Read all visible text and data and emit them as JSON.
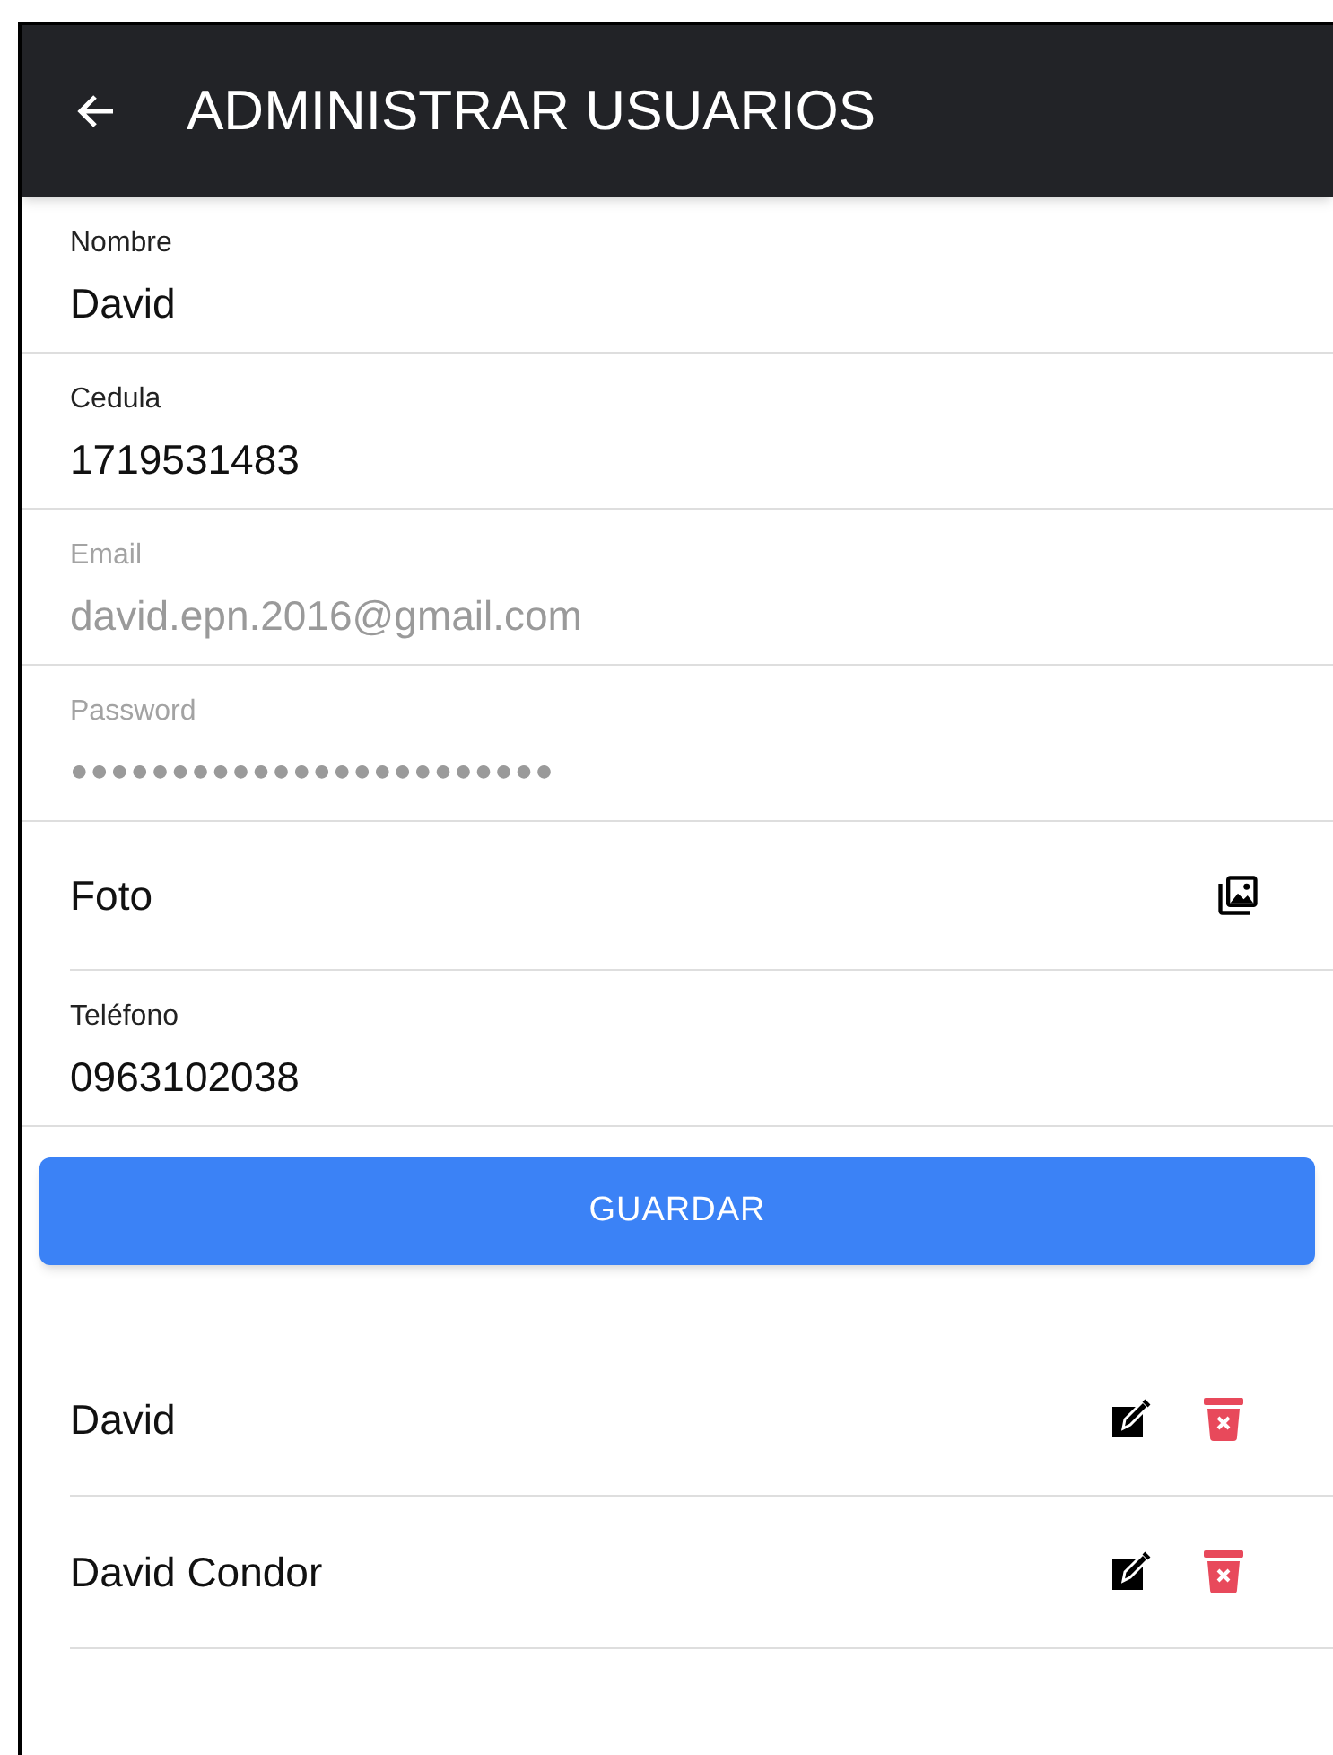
{
  "header": {
    "title": "ADMINISTRAR USUARIOS"
  },
  "fields": [
    {
      "kind": "text",
      "label": "Nombre",
      "value": "David",
      "disabled": false
    },
    {
      "kind": "text",
      "label": "Cedula",
      "value": "1719531483",
      "disabled": false
    },
    {
      "kind": "text",
      "label": "Email",
      "value": "david.epn.2016@gmail.com",
      "disabled": true
    },
    {
      "kind": "password",
      "label": "Password",
      "value": "●●●●●●●●●●●●●●●●●●●●●●●●",
      "disabled": true
    },
    {
      "kind": "file",
      "label": "Foto"
    },
    {
      "kind": "text",
      "label": "Teléfono",
      "value": "0963102038",
      "disabled": false
    }
  ],
  "save_button": {
    "label": "GUARDAR"
  },
  "users": [
    {
      "name": "David"
    },
    {
      "name": "David Condor"
    }
  ]
}
